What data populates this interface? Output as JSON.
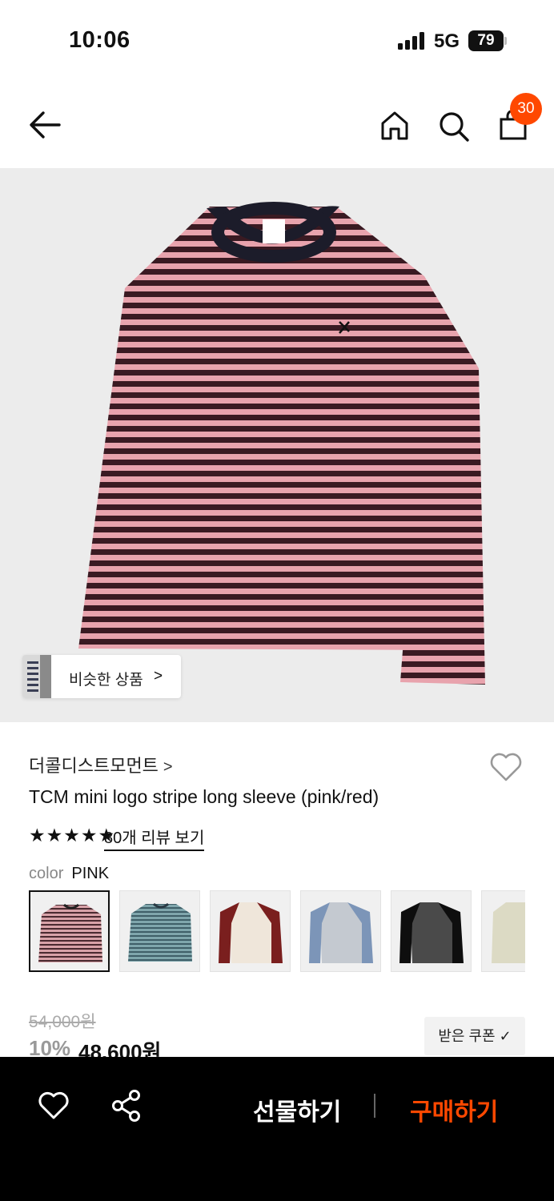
{
  "status_bar": {
    "time": "10:06",
    "network": "5G",
    "battery": "79"
  },
  "nav": {
    "cart_count": "30",
    "icons": [
      "back-arrow-icon",
      "home-icon",
      "search-icon",
      "shopping-bag-icon"
    ]
  },
  "hero": {
    "similar_label": "비슷한 상품",
    "similar_chevron": ">"
  },
  "product": {
    "brand": "더콜디스트모먼트",
    "brand_arrow": ">",
    "title": "TCM mini logo stripe long sleeve (pink/red)",
    "stars": "★★★★★",
    "review_link": "80개 리뷰 보기",
    "color_label": "color",
    "color_value": "PINK",
    "original_price": "54,000원",
    "discount": "10%",
    "final_price": "48,600원",
    "coupon_label": "받은 쿠폰 ✓"
  },
  "colors": {
    "pink_stripe": "#e8a3ad",
    "dark_stripe": "#3a1a22",
    "accent": "#ff4800"
  },
  "swatches": [
    {
      "name": "pink-stripe",
      "selected": true
    },
    {
      "name": "teal-stripe",
      "selected": false
    },
    {
      "name": "cream-burgundy-raglan",
      "selected": false
    },
    {
      "name": "grey-blue-raglan",
      "selected": false
    },
    {
      "name": "charcoal-black-raglan",
      "selected": false
    },
    {
      "name": "beige",
      "selected": false
    }
  ],
  "bottom_bar": {
    "gift_label": "선물하기",
    "buy_label": "구매하기"
  }
}
